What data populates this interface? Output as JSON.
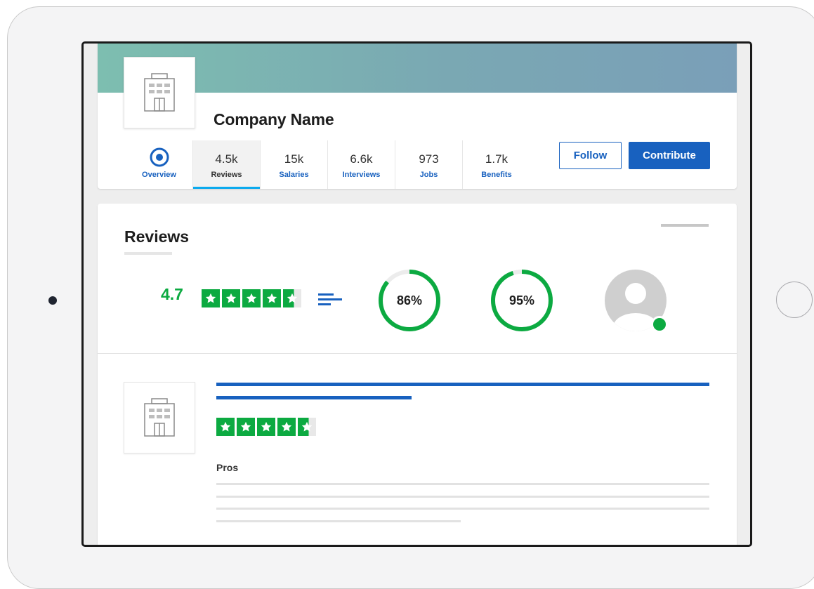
{
  "company": {
    "name": "Company Name"
  },
  "tabs": [
    {
      "id": "overview",
      "label": "Overview",
      "count": ""
    },
    {
      "id": "reviews",
      "label": "Reviews",
      "count": "4.5k"
    },
    {
      "id": "salaries",
      "label": "Salaries",
      "count": "15k"
    },
    {
      "id": "interviews",
      "label": "Interviews",
      "count": "6.6k"
    },
    {
      "id": "jobs",
      "label": "Jobs",
      "count": "973"
    },
    {
      "id": "benefits",
      "label": "Benefits",
      "count": "1.7k"
    }
  ],
  "active_tab": "reviews",
  "actions": {
    "follow_label": "Follow",
    "contribute_label": "Contribute"
  },
  "reviews": {
    "title": "Reviews",
    "rating": "4.7",
    "rating_stars": 4.6,
    "recommend_percent": "86%",
    "recommend_value": 86,
    "ceo_approval_percent": "95%",
    "ceo_approval_value": 95
  },
  "review_item": {
    "rating_stars": 4.6,
    "pros_label": "Pros"
  },
  "colors": {
    "brand_blue": "#1861bf",
    "rating_green": "#0caa41",
    "active_tab_accent": "#0caaee"
  },
  "icons": {
    "company_logo": "building-icon",
    "overview": "target-icon",
    "ratings_breakdown": "bar-list-icon",
    "ceo": "user-avatar-icon"
  }
}
